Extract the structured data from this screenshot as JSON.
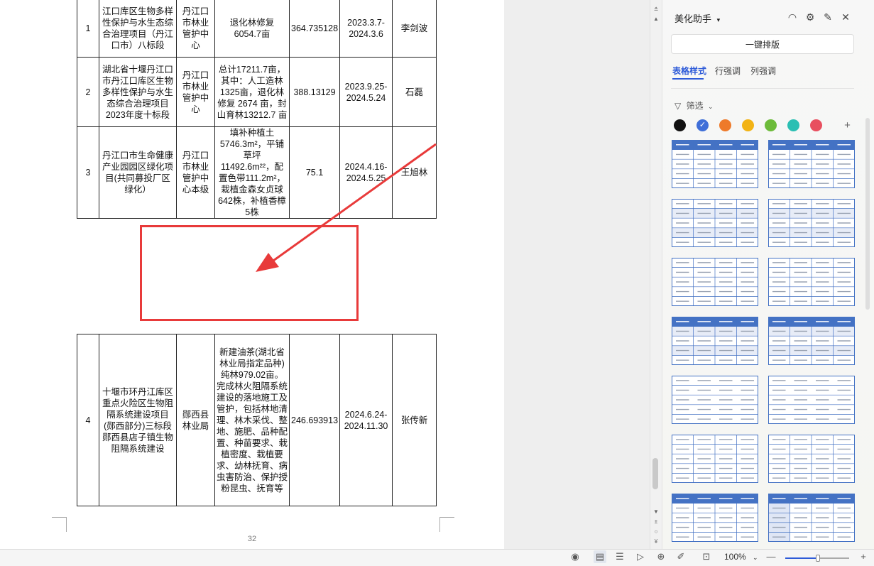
{
  "document": {
    "page_number": "32",
    "table_top": [
      {
        "no": "1",
        "name": "江口库区生物多样性保护与水生态综合治理项目（丹江口市）八标段",
        "unit": "丹江口市林业管护中心",
        "content": "退化林修复6054.7亩",
        "amount": "364.735128",
        "period": "2023.3.7-2024.3.6",
        "person": "李剑波"
      },
      {
        "no": "2",
        "name": "湖北省十堰丹江口市丹江口库区生物多样性保护与水生态综合治理项目2023年度十标段",
        "unit": "丹江口市林业管护中心",
        "content": "总计17211.7亩，其中：人工造林1325亩，退化林修复 2674 亩，封山育林13212.7 亩",
        "amount": "388.13129",
        "period": "2023.9.25-2024.5.24",
        "person": "石磊"
      },
      {
        "no": "3",
        "name": "丹江口市生命健康产业园园区绿化项目(共同募投厂区绿化）",
        "unit": "丹江口市林业管护中心本级",
        "content": "填补种植土5746.3m²，平铺草坪 11492.6m²²，配置色带111.2m²，栽植金森女贞球642株，补植香樟5株",
        "amount": "75.1",
        "period": "2024.4.16-2024.5.25",
        "person": "王旭林"
      }
    ],
    "table_bottom": [
      {
        "no": "4",
        "name": "十堰市环丹江库区重点火险区生物阻隔系统建设项目(郧西部分)三标段郧西县店子镇生物阻隔系统建设",
        "unit": "郧西县林业局",
        "content": "新建油茶(湖北省林业局指定品种)纯林979.02亩。完成林火阻隔系统建设的落地施工及管护，包括林地清理、林木采伐、整地、施肥、品种配置、种苗要求、栽植密度、栽植要求、幼林抚育、病虫害防治、保护授粉昆虫、抚育等",
        "amount": "246.693913",
        "period": "2024.6.24-2024.11.30",
        "person": "张传新"
      }
    ]
  },
  "annotation": {
    "color": "#e83a3a"
  },
  "panel": {
    "title": "美化助手",
    "one_key_label": "一键排版",
    "tabs": [
      "表格样式",
      "行强调",
      "列强调"
    ],
    "filter_label": "筛选",
    "swatches": [
      "#111111",
      "#3f6fd8",
      "#ee7a2a",
      "#f2b315",
      "#6cbb3a",
      "#2bbfb3",
      "#e84f5f"
    ],
    "accent_color": "#4472c4"
  },
  "status": {
    "zoom": "100%"
  }
}
